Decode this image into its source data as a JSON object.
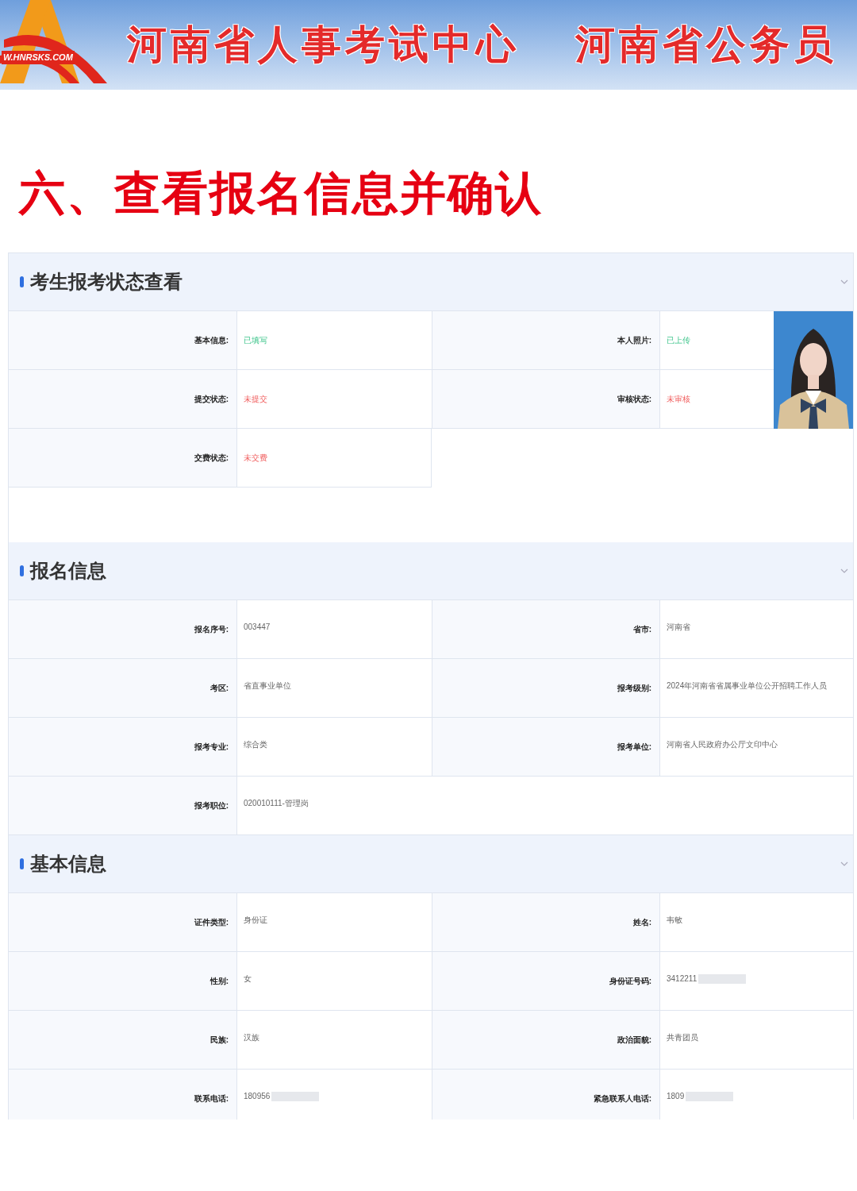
{
  "banner": {
    "logo_text": "W.HNRSKS.COM",
    "titles": [
      "河南省人事考试中心",
      "河南省公务员"
    ]
  },
  "heading": "六、查看报名信息并确认",
  "sections": [
    {
      "title": "考生报考状态查看",
      "photo": {
        "kind": "picture"
      },
      "rows": [
        [
          {
            "label": "基本信息:",
            "value": "已填写",
            "complete": true
          },
          {
            "label": "本人照片:",
            "value": "已上传",
            "complete": true
          }
        ],
        [
          {
            "label": "提交状态:",
            "value": "未提交",
            "complete": false
          },
          {
            "label": "审核状态:",
            "value": "未审核",
            "complete": false
          }
        ],
        [
          {
            "label": "交费状态:",
            "value": "未交费",
            "complete": false
          }
        ]
      ]
    },
    {
      "title": "报名信息",
      "rows": [
        [
          {
            "label": "报名序号:",
            "value": "003447"
          },
          {
            "label": "省市:",
            "value": "河南省"
          }
        ],
        [
          {
            "label": "考区:",
            "value": "省直事业单位"
          },
          {
            "label": "报考级别:",
            "value": "2024年河南省省属事业单位公开招聘工作人员"
          }
        ],
        [
          {
            "label": "报考专业:",
            "value": "综合类"
          },
          {
            "label": "报考单位:",
            "value": "河南省人民政府办公厅文印中心"
          }
        ],
        [
          {
            "label": "报考职位:",
            "value": "020010111-管理岗"
          }
        ]
      ]
    },
    {
      "title": "基本信息",
      "rows": [
        [
          {
            "label": "证件类型:",
            "value": "身份证"
          },
          {
            "label": "姓名:",
            "value": "韦敏"
          }
        ],
        [
          {
            "label": "性别:",
            "value": "女"
          },
          {
            "label": "身份证号码:",
            "value": "3412211",
            "redacted": true
          }
        ],
        [
          {
            "label": "民族:",
            "value": "汉族"
          },
          {
            "label": "政治面貌:",
            "value": "共青团员"
          }
        ],
        [
          {
            "label": "联系电话:",
            "value": "180956",
            "redacted": true
          },
          {
            "label": "紧急联系人电话:",
            "value": "1809",
            "redacted": true
          }
        ]
      ]
    }
  ]
}
